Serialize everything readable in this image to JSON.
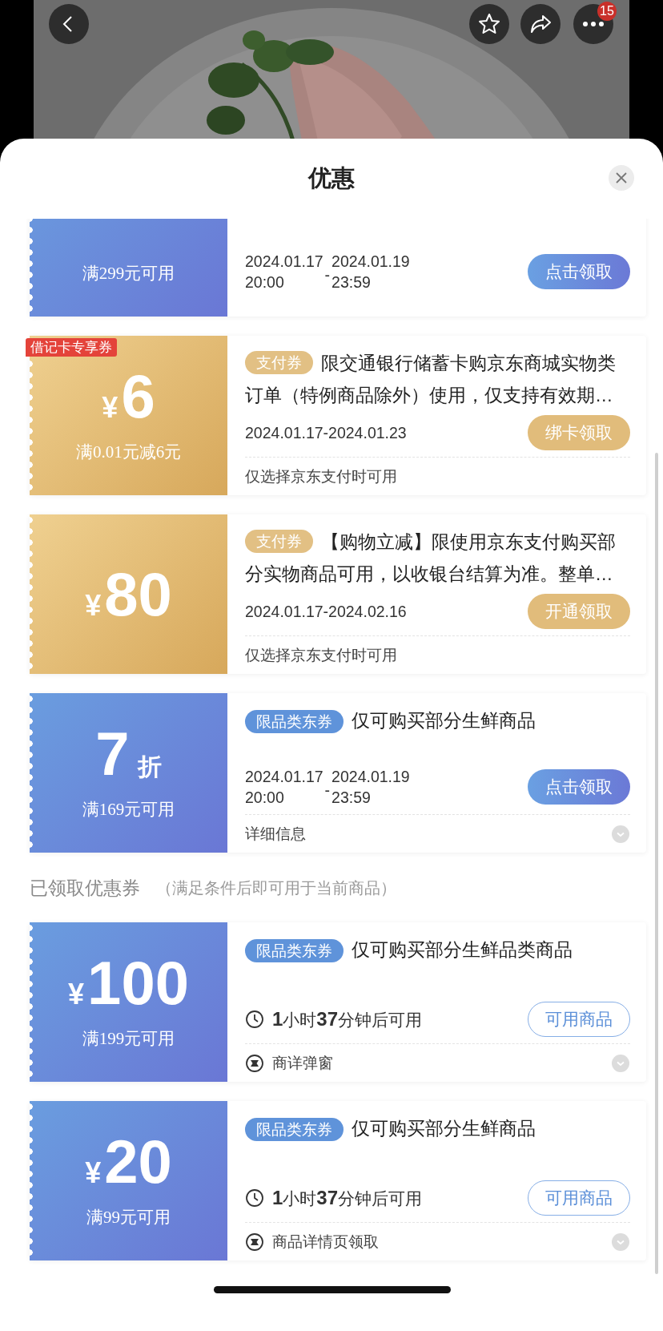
{
  "top_bar": {
    "notification_count": "15"
  },
  "sheet": {
    "title": "优惠"
  },
  "coupons": [
    {
      "kind": "blue",
      "condition": "满299元可用",
      "validity": {
        "from": [
          "2024.01.17",
          "20:00"
        ],
        "dash": "-",
        "to": [
          "2024.01.19",
          "23:59"
        ]
      },
      "button": {
        "label": "点击领取",
        "kind": "fill"
      }
    },
    {
      "kind": "gold",
      "ribbon": "借记卡专享券",
      "amount": {
        "currency": "¥",
        "value": "6"
      },
      "condition": "满0.01元减6元",
      "tag": "支付券",
      "description": "限交通银行储蓄卡购京东商城实物类订单（特例商品除外）使用，仅支持有效期…",
      "validity_text": "2024.01.17-2024.01.23",
      "button": {
        "label": "绑卡领取",
        "kind": "fill"
      },
      "footer": {
        "kind": "note",
        "text": "仅选择京东支付时可用",
        "expandable": false
      }
    },
    {
      "kind": "gold",
      "amount": {
        "currency": "¥",
        "value": "80"
      },
      "tag": "支付券",
      "description": "【购物立减】限使用京东支付购买部分实物商品可用，以收银台结算为准。整单…",
      "validity_text": "2024.01.17-2024.02.16",
      "button": {
        "label": "开通领取",
        "kind": "fill"
      },
      "footer": {
        "kind": "note",
        "text": "仅选择京东支付时可用",
        "expandable": false
      }
    },
    {
      "kind": "blue",
      "amount": {
        "value": "7",
        "unit": "折"
      },
      "condition": "满169元可用",
      "tag": "限品类东券",
      "description": "仅可购买部分生鲜商品",
      "validity": {
        "from": [
          "2024.01.17",
          "20:00"
        ],
        "dash": "-",
        "to": [
          "2024.01.19",
          "23:59"
        ]
      },
      "button": {
        "label": "点击领取",
        "kind": "fill"
      },
      "footer": {
        "kind": "note",
        "text": "详细信息",
        "expandable": true
      }
    }
  ],
  "claimed_section": {
    "title": "已领取优惠券",
    "note": "（满足条件后即可用于当前商品）"
  },
  "claimed": [
    {
      "kind": "blue",
      "amount": {
        "currency": "¥",
        "value": "100"
      },
      "condition": "满199元可用",
      "tag": "限品类东券",
      "description": "仅可购买部分生鲜品类商品",
      "status": "**1**小时**37**分钟后可用",
      "button": {
        "label": "可用商品",
        "kind": "outline"
      },
      "footer": {
        "kind": "source",
        "text": "商详弹窗",
        "expandable": true
      }
    },
    {
      "kind": "blue",
      "amount": {
        "currency": "¥",
        "value": "20"
      },
      "condition": "满99元可用",
      "tag": "限品类东券",
      "description": "仅可购买部分生鲜商品",
      "status": "**1**小时**37**分钟后可用",
      "button": {
        "label": "可用商品",
        "kind": "outline"
      },
      "footer": {
        "kind": "source",
        "text": "商品详情页领取",
        "expandable": true
      }
    }
  ]
}
